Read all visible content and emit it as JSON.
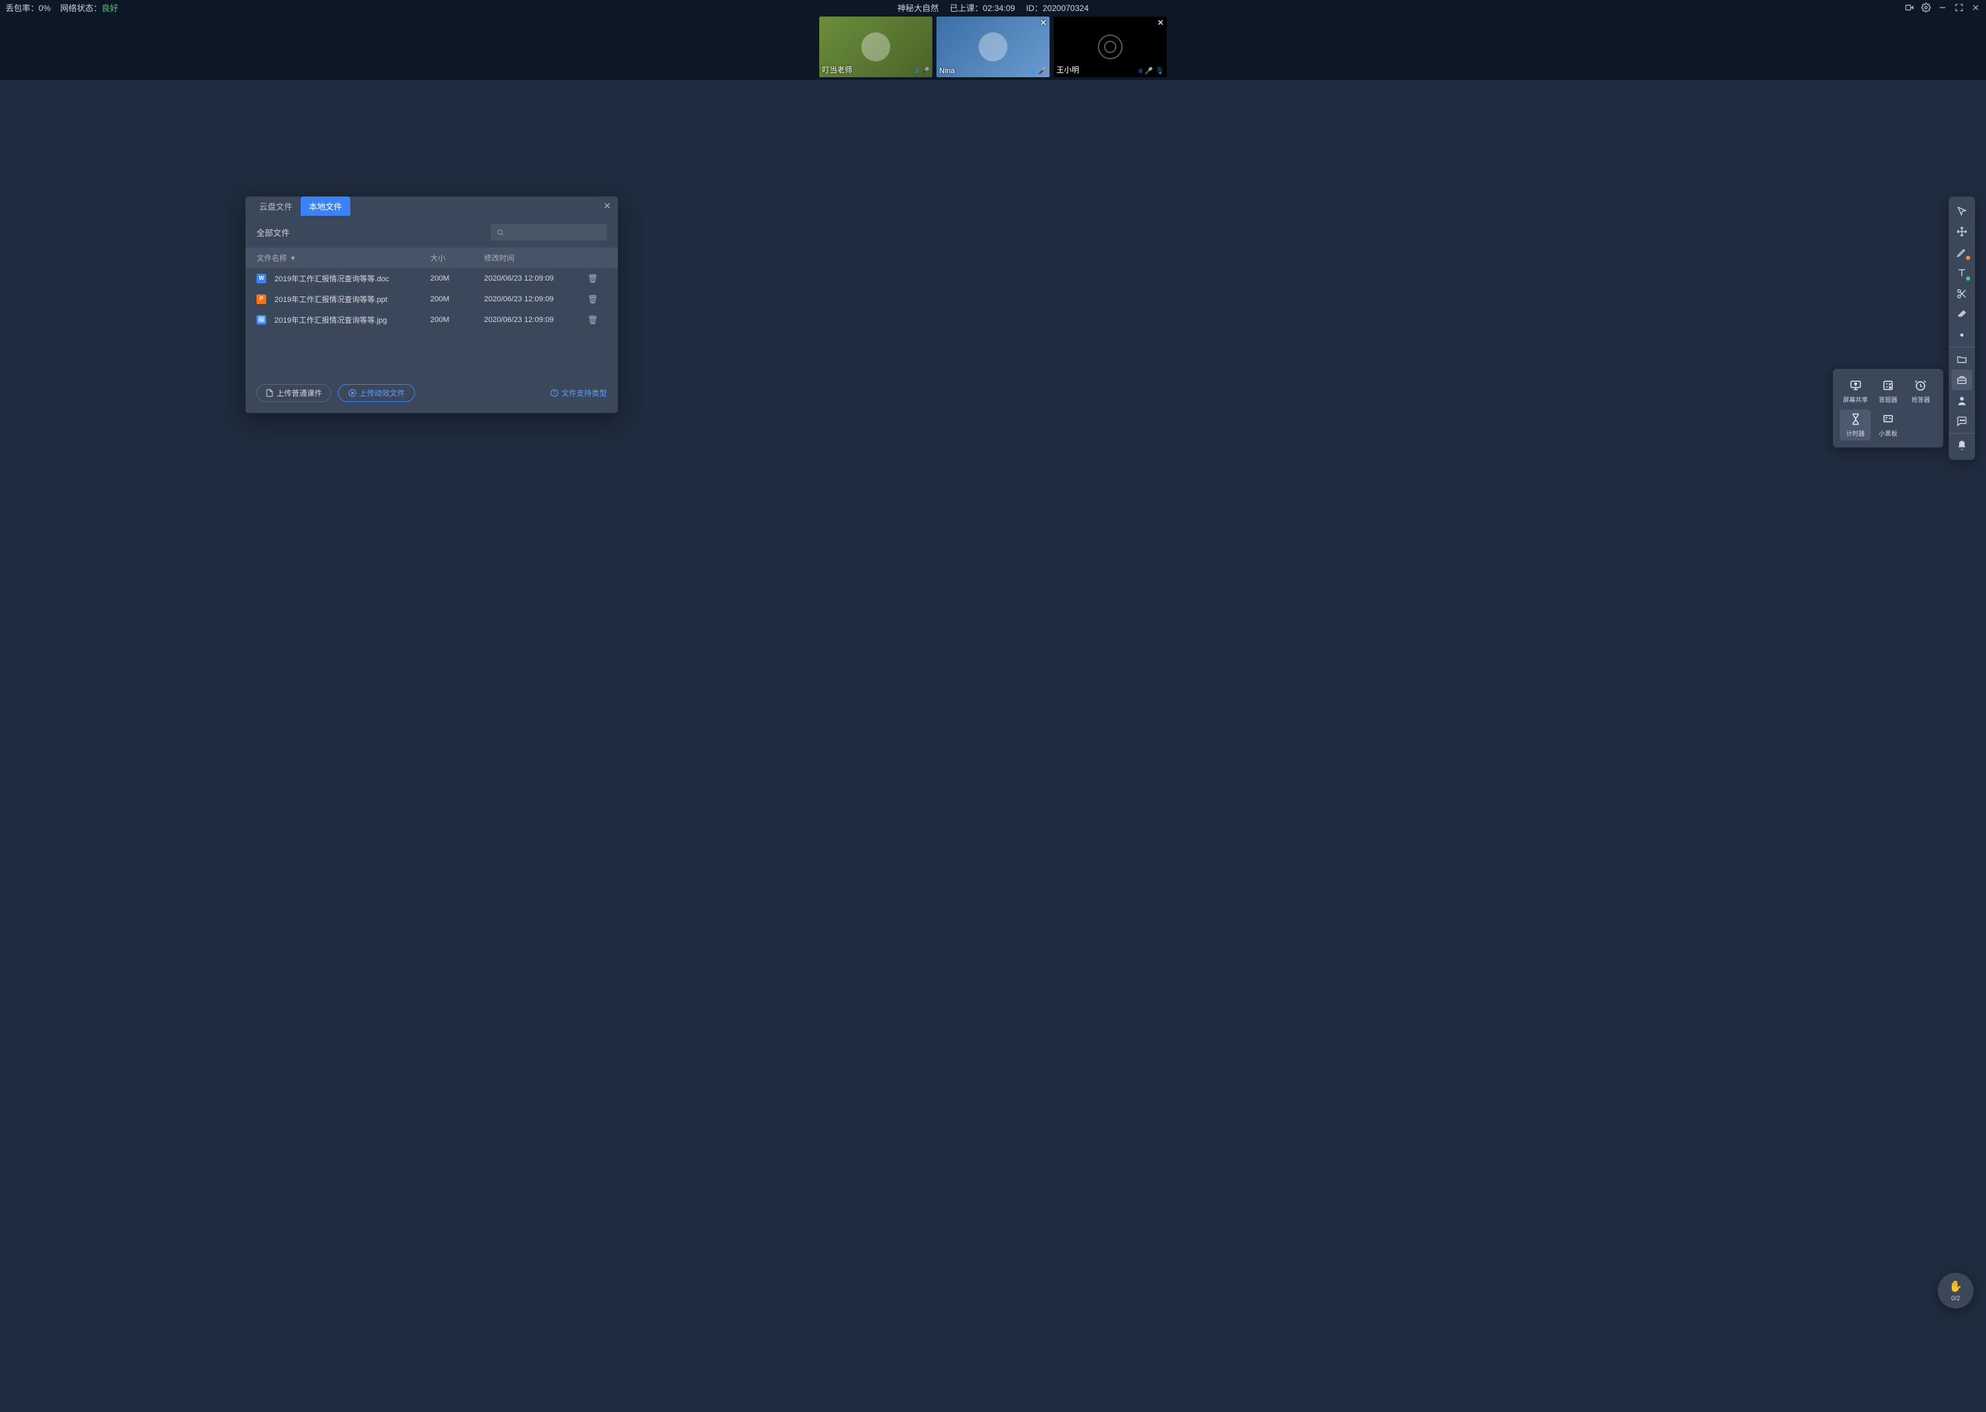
{
  "topbar": {
    "packet_loss_label": "丢包率：",
    "packet_loss_value": "0%",
    "network_label": "网络状态：",
    "network_value": "良好",
    "room_title": "神秘大自然",
    "classed_label": "已上课：",
    "classed_value": "02:34:09",
    "id_label": "ID：",
    "id_value": "2020070324"
  },
  "participants": [
    {
      "name": "叮当老师",
      "camera": "on",
      "mic": "on",
      "is_host": true
    },
    {
      "name": "Nina",
      "camera": "on",
      "mic": "on",
      "is_host": false
    },
    {
      "name": "王小明",
      "camera": "off",
      "mic": "off",
      "is_host": false
    }
  ],
  "dialog": {
    "tabs": {
      "cloud": "云盘文件",
      "local": "本地文件"
    },
    "all_files_label": "全部文件",
    "columns": {
      "name": "文件名称",
      "size": "大小",
      "time": "修改时间"
    },
    "files": [
      {
        "icon": "W",
        "name": "2019年工作汇报情况查询等等.doc",
        "size": "200M",
        "time": "2020/06/23 12:09:09"
      },
      {
        "icon": "P",
        "name": "2019年工作汇报情况查询等等.ppt",
        "size": "200M",
        "time": "2020/06/23 12:09:09"
      },
      {
        "icon": "I",
        "name": "2019年工作汇报情况查询等等.jpg",
        "size": "200M",
        "time": "2020/06/23 12:09:09"
      }
    ],
    "upload_normal": "上传普通课件",
    "upload_dynamic": "上传动效文件",
    "support_link": "文件支持类型"
  },
  "tool_popover": {
    "items": [
      {
        "id": "screen-share",
        "label": "屏幕共享"
      },
      {
        "id": "answer",
        "label": "答题器"
      },
      {
        "id": "responder",
        "label": "抢答器"
      },
      {
        "id": "timer",
        "label": "计时器"
      },
      {
        "id": "blackboard",
        "label": "小黑板"
      }
    ]
  },
  "hand": {
    "count": "0/2"
  }
}
